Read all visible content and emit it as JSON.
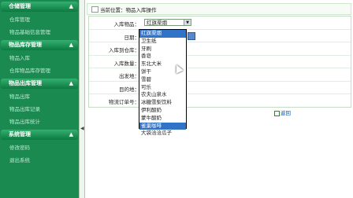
{
  "sidebar": {
    "groups": [
      {
        "title": "仓储管理",
        "items": [
          "仓库管理",
          "物品基础信息管理"
        ]
      },
      {
        "title": "物品库存管理",
        "items": [
          "物品入库",
          "仓库物品库存管理"
        ]
      },
      {
        "title": "物品出库管理",
        "items": [
          "物品出库",
          "物品出库记录",
          "物品出库统计"
        ]
      },
      {
        "title": "系统管理",
        "items": [
          "修改密码",
          "退出系统"
        ]
      }
    ]
  },
  "breadcrumb": "当前位置：物品入库操作",
  "form": {
    "labels": [
      "入库物品：",
      "日期：",
      "入库到仓库：",
      "入库数量：",
      "出发地：",
      "目的地：",
      "物流订单号："
    ],
    "selected_item": "红旗渠烟"
  },
  "dropdown": {
    "options": [
      "红旗渠烟",
      "卫生纸",
      "牙刷",
      "香皂",
      "东北大米",
      "饼干",
      "雪碧",
      "可乐",
      "农夫山泉水",
      "冰糖雪梨饮料",
      "伊利酸奶",
      "蒙牛酸奶",
      "雀巢咖啡",
      "大袋洽洽瓜子"
    ],
    "highlighted_index": 12
  },
  "return_label": "返回"
}
